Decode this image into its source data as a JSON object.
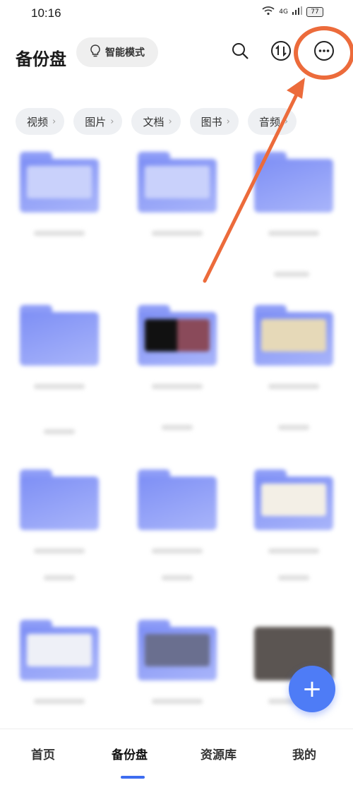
{
  "status": {
    "time": "10:16",
    "battery": "77",
    "signal": "4G"
  },
  "header": {
    "title": "备份盘",
    "mode_label": "智能模式",
    "icons": [
      "search-icon",
      "transfer-icon",
      "more-icon"
    ]
  },
  "chips": [
    {
      "label": "视频"
    },
    {
      "label": "图片"
    },
    {
      "label": "文档"
    },
    {
      "label": "图书"
    },
    {
      "label": "音频"
    }
  ],
  "bottom_nav": {
    "items": [
      "首页",
      "备份盘",
      "资源库",
      "我的"
    ],
    "active": "备份盘"
  },
  "fab": {
    "label": "+"
  },
  "colors": {
    "accent": "#3d6cf0",
    "folder": "#8d9cf7",
    "annotation": "#ec6b3b"
  }
}
